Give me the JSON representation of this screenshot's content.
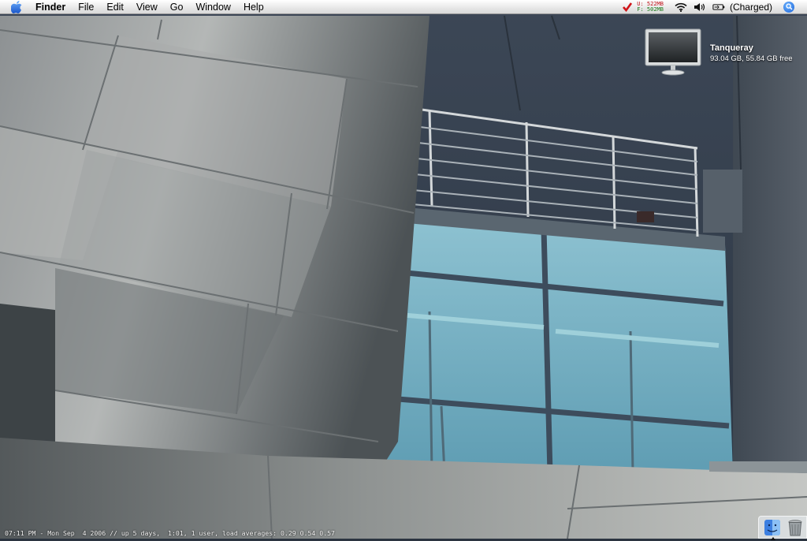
{
  "menubar": {
    "menus": [
      "Finder",
      "File",
      "Edit",
      "View",
      "Go",
      "Window",
      "Help"
    ],
    "memory": {
      "used": "U:  522MB",
      "free": "F:  502MB"
    },
    "battery": "(Charged)",
    "icons": [
      "apple-icon",
      "check-icon",
      "wifi-icon",
      "volume-icon",
      "battery-icon",
      "spotlight-icon"
    ]
  },
  "desktop": {
    "volume": {
      "name": "Tanqueray",
      "info": "93.04 GB, 55.84 GB free"
    },
    "status_line": "07:11 PM - Mon Sep  4 2006 // up 5 days,  1:01, 1 user, load averages: 0.29 0.54 0.57"
  },
  "dock": {
    "items": [
      "finder-icon",
      "trash-icon"
    ]
  },
  "colors": {
    "menubar": "#e9e9e9",
    "accent_blue": "#1a63d8",
    "mem_used": "#c0141b",
    "mem_free": "#1b7a1b"
  }
}
